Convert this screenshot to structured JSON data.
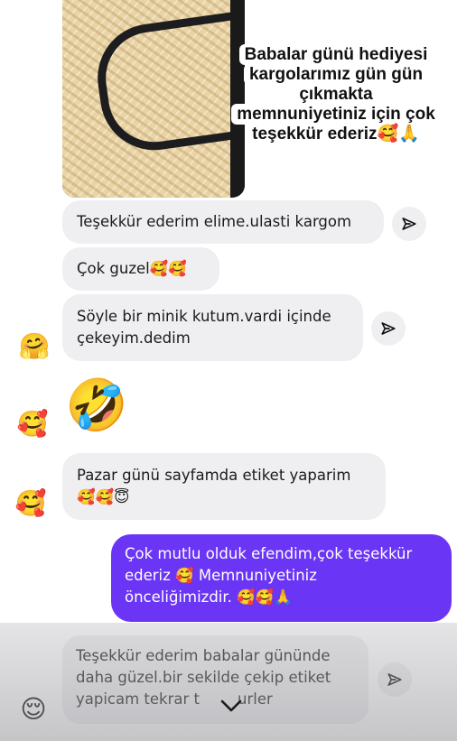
{
  "caption": {
    "line1": "Babalar günü hediyesi",
    "line2": "kargolarımız gün gün",
    "line3": "çıkmakta",
    "line4": "memnuniyetiniz için çok",
    "line5": "teşekkür ederiz🥰🙏"
  },
  "messages": [
    {
      "text": "Teşekkür ederim elime.ulasti kargom"
    },
    {
      "text": "Çok guzel🥰🥰"
    },
    {
      "line1": "Söyle bir minik kutum.vardi içinde",
      "line2": "çekeyim.dedim"
    },
    {
      "emoji": "🤣"
    },
    {
      "line1": "Pazar günü sayfamda etiket yaparim",
      "line2": "🥰🥰😇"
    },
    {
      "line1": "Teşekkür ederim babalar gününde",
      "line2": "daha güzel.bir sekilde çekip etiket",
      "line3": "yapicam tekrar t",
      "line3_end": "urler"
    }
  ],
  "outgoing": {
    "line1": "Çok mutlu olduk efendim,çok teşekkür",
    "line2": "ederiz 🥰 Memnuniyetiniz",
    "line3": "önceliğimizdir. 🥰🥰🙏"
  },
  "reactions": [
    "🤗",
    "🥰",
    "🥰",
    "😌"
  ],
  "colors": {
    "outgoing_bubble": "#6a35f5",
    "incoming_bubble": "#efeff1"
  },
  "icons": {
    "share": "send-arrow-icon",
    "scroll": "chevron-down-icon"
  }
}
